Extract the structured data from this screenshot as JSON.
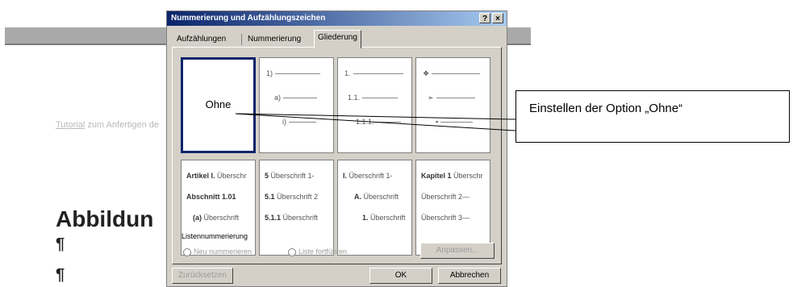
{
  "document": {
    "tutorial_link": "Tutorial",
    "tutorial_rest": " zum Anfertigen de",
    "heading": "Abbildun",
    "pilcrow": "¶"
  },
  "dialog": {
    "title": "Nummerierung und Aufzählungszeichen",
    "help_btn": "?",
    "close_btn": "×",
    "tabs": [
      "Aufzählungen",
      "Nummerierung",
      "Gliederung"
    ],
    "grid": {
      "r1c1": "Ohne",
      "r1c2": [
        "1)",
        "a)",
        "i)"
      ],
      "r1c3": [
        "1.",
        "1.1.",
        "1.1.1."
      ],
      "r1c4": [
        "❖",
        "➢",
        "▪"
      ],
      "r2c1": [
        "Artikel I.",
        "Überschr",
        "Abschnitt 1.01",
        "(a)",
        "Überschrift"
      ],
      "r2c2": [
        "5",
        "Überschrift 1-",
        "5.1",
        "Überschrift 2",
        "5.1.1",
        "Überschrift"
      ],
      "r2c3": [
        "I.",
        "Überschrift 1-",
        "A.",
        "Überschrift",
        "1.",
        "Überschrift"
      ],
      "r2c4": [
        "Kapitel 1",
        "Überschr",
        "Überschrift 2—",
        "Überschrift 3—"
      ]
    },
    "list_numbering_label": "Listennummerierung",
    "radio_restart": "Neu nummerieren",
    "radio_continue": "Liste fortführen",
    "customize_btn": "Anpassen...",
    "reset_btn": "Zurücksetzen",
    "ok_btn": "OK",
    "cancel_btn": "Abbrechen"
  },
  "callout": {
    "text": "Einstellen der Option „Ohne“"
  },
  "colors": {
    "title_start": "#0a246a",
    "title_end": "#a6caf0",
    "dialog_bg": "#d4d0c8"
  }
}
